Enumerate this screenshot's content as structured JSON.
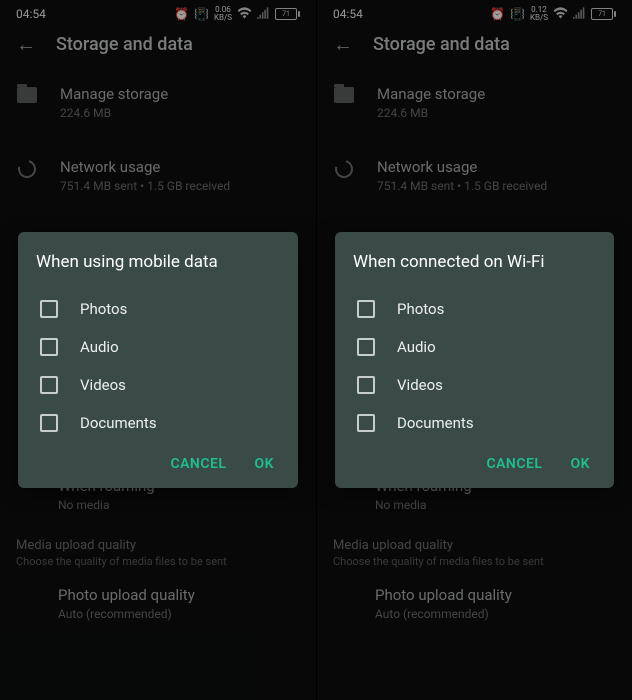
{
  "left": {
    "statusbar": {
      "time": "04:54",
      "speed_value": "0.06",
      "speed_unit": "KB/S",
      "battery": "71"
    },
    "header": {
      "title": "Storage and data"
    },
    "storage": {
      "title": "Manage storage",
      "sub": "224.6 MB"
    },
    "network": {
      "title": "Network usage",
      "sub": "751.4 MB sent • 1.5 GB received"
    },
    "roaming": {
      "title": "When roaming",
      "sub": "No media"
    },
    "upload_header": "Media upload quality",
    "upload_desc": "Choose the quality of media files to be sent",
    "photo_quality": {
      "title": "Photo upload quality",
      "sub": "Auto (recommended)"
    },
    "dialog": {
      "title": "When using mobile data",
      "opts": {
        "photos": "Photos",
        "audio": "Audio",
        "videos": "Videos",
        "docs": "Documents"
      },
      "cancel": "CANCEL",
      "ok": "OK"
    }
  },
  "right": {
    "statusbar": {
      "time": "04:54",
      "speed_value": "0.12",
      "speed_unit": "KB/S",
      "battery": "71"
    },
    "header": {
      "title": "Storage and data"
    },
    "storage": {
      "title": "Manage storage",
      "sub": "224.6 MB"
    },
    "network": {
      "title": "Network usage",
      "sub": "751.4 MB sent • 1.5 GB received"
    },
    "roaming": {
      "title": "When roaming",
      "sub": "No media"
    },
    "upload_header": "Media upload quality",
    "upload_desc": "Choose the quality of media files to be sent",
    "photo_quality": {
      "title": "Photo upload quality",
      "sub": "Auto (recommended)"
    },
    "dialog": {
      "title": "When connected on Wi-Fi",
      "opts": {
        "photos": "Photos",
        "audio": "Audio",
        "videos": "Videos",
        "docs": "Documents"
      },
      "cancel": "CANCEL",
      "ok": "OK"
    }
  }
}
